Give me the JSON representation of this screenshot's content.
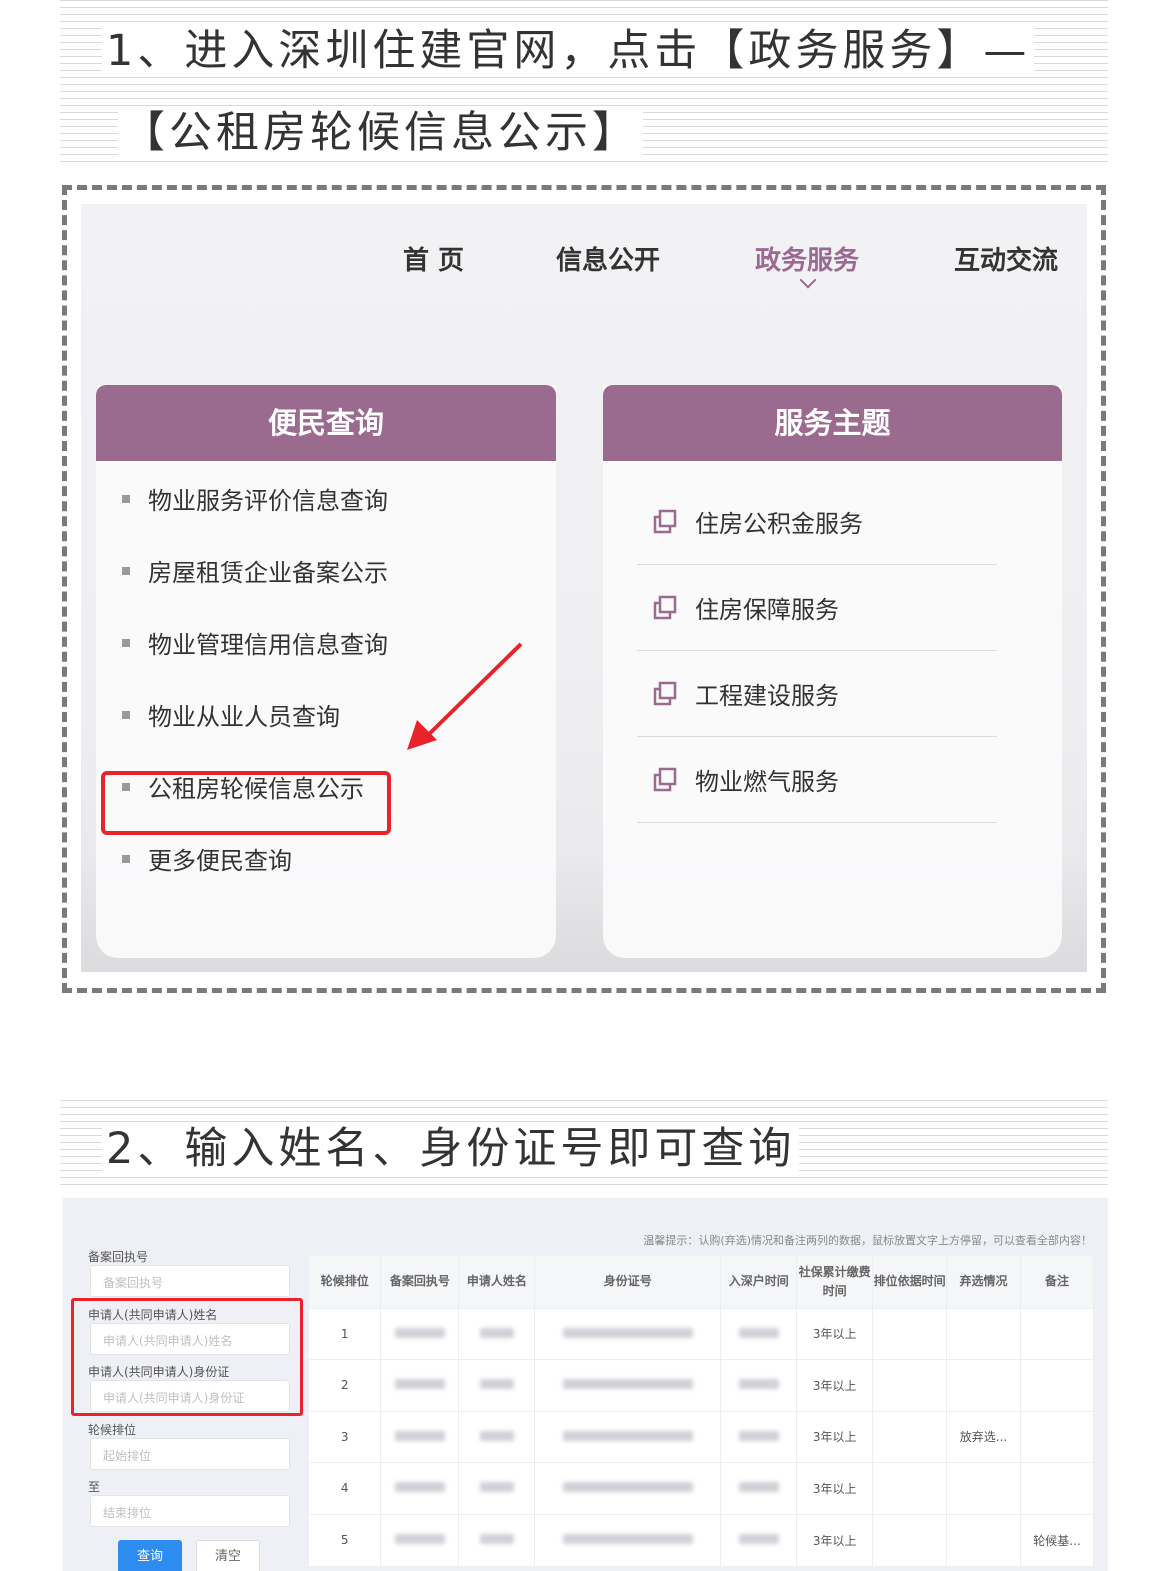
{
  "step1": {
    "line1": "1、进入深圳住建官网，点击【政务服务】—",
    "line2": "【公租房轮候信息公示】"
  },
  "step2": {
    "title": "2、输入姓名、身份证号即可查询"
  },
  "site_nav": [
    {
      "label": "首 页"
    },
    {
      "label": "信息公开"
    },
    {
      "label": "政务服务",
      "active": true
    },
    {
      "label": "互动交流"
    }
  ],
  "left_panel": {
    "title": "便民查询",
    "items": [
      "物业服务评价信息查询",
      "房屋租赁企业备案公示",
      "物业管理信用信息查询",
      "物业从业人员查询",
      "公租房轮候信息公示",
      "更多便民查询"
    ],
    "highlighted_index": 4
  },
  "right_panel": {
    "title": "服务主题",
    "items": [
      "住房公积金服务",
      "住房保障服务",
      "工程建设服务",
      "物业燃气服务"
    ]
  },
  "colors": {
    "accent": "#9b6a8f",
    "highlight": "#e8232a",
    "primary_button": "#2d8cf0"
  },
  "query_page": {
    "tip": "温馨提示：认购(弃选)情况和备注两列的数据，鼠标放置文字上方停留，可以查看全部内容！",
    "fields": [
      {
        "label": "备案回执号",
        "placeholder": "备案回执号"
      },
      {
        "label": "申请人(共同申请人)姓名",
        "placeholder": "申请人(共同申请人)姓名"
      },
      {
        "label": "申请人(共同申请人)身份证",
        "placeholder": "申请人(共同申请人)身份证"
      },
      {
        "label": "轮候排位",
        "placeholder": "起始排位"
      },
      {
        "label": "至",
        "placeholder": "结束排位"
      }
    ],
    "query_button": "查询",
    "clear_button": "清空",
    "columns": [
      "轮候排位",
      "备案回执号",
      "申请人姓名",
      "身份证号",
      "入深户时间",
      "社保累计缴费时间",
      "排位依据时间",
      "弃选情况",
      "备注"
    ],
    "rows": [
      {
        "rank": "1",
        "social": "3年以上",
        "abandon": "",
        "remark": ""
      },
      {
        "rank": "2",
        "social": "3年以上",
        "abandon": "",
        "remark": ""
      },
      {
        "rank": "3",
        "social": "3年以上",
        "abandon": "放弃选...",
        "remark": ""
      },
      {
        "rank": "4",
        "social": "3年以上",
        "abandon": "",
        "remark": ""
      },
      {
        "rank": "5",
        "social": "3年以上",
        "abandon": "",
        "remark": "轮候基..."
      }
    ]
  }
}
